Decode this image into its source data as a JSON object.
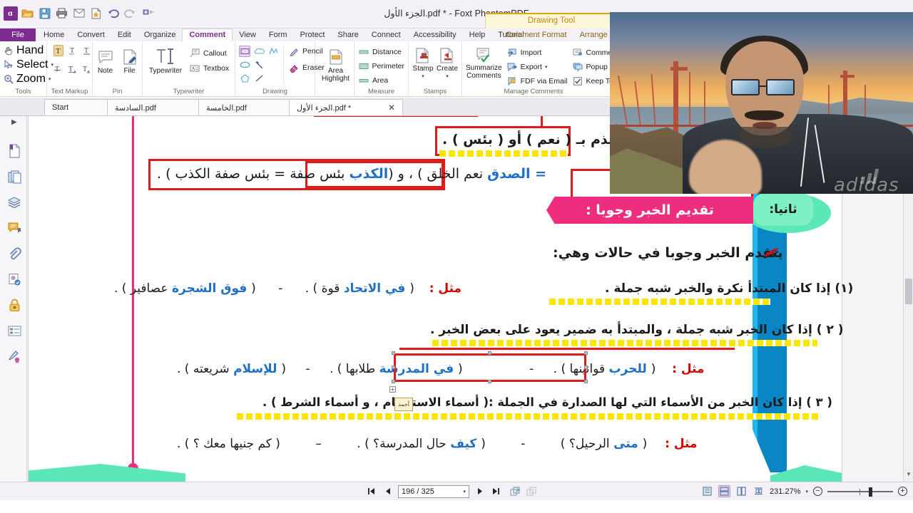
{
  "window": {
    "title": "الجزء الأول.pdf * - Foxt PhantomPDF",
    "app_logo_glyph": "ɑ",
    "contextual_tab_banner": "Drawing Tool"
  },
  "quick_access": [
    {
      "name": "app-menu-icon",
      "tooltip": "Foxit"
    },
    {
      "name": "open-icon",
      "tooltip": "Open"
    },
    {
      "name": "save-icon",
      "tooltip": "Save"
    },
    {
      "name": "print-icon",
      "tooltip": "Print"
    },
    {
      "name": "email-icon",
      "tooltip": "Email"
    },
    {
      "name": "new-from-file-icon",
      "tooltip": "Create PDF"
    },
    {
      "name": "undo-icon",
      "tooltip": "Undo"
    },
    {
      "name": "redo-icon",
      "tooltip": "Redo"
    },
    {
      "name": "customize-icon",
      "tooltip": "Customize Quick Access Toolbar"
    }
  ],
  "menu": {
    "file_label": "File",
    "tabs": [
      {
        "label": "Home",
        "active": false
      },
      {
        "label": "Convert",
        "active": false
      },
      {
        "label": "Edit",
        "active": false
      },
      {
        "label": "Organize",
        "active": false
      },
      {
        "label": "Comment",
        "active": true
      },
      {
        "label": "View",
        "active": false
      },
      {
        "label": "Form",
        "active": false
      },
      {
        "label": "Protect",
        "active": false
      },
      {
        "label": "Share",
        "active": false
      },
      {
        "label": "Connect",
        "active": false
      },
      {
        "label": "Accessibility",
        "active": false
      },
      {
        "label": "Help",
        "active": false
      },
      {
        "label": "Tutorial",
        "active": false
      }
    ],
    "contextual_tabs": [
      {
        "label": "Comment Format"
      },
      {
        "label": "Arrange"
      }
    ]
  },
  "ribbon": {
    "groups": [
      {
        "name": "tools",
        "label": "Tools",
        "items": [
          {
            "label": "Hand",
            "icon": "hand-icon"
          },
          {
            "label": "Select",
            "icon": "select-icon",
            "has_caret": true
          },
          {
            "label": "Zoom",
            "icon": "zoom-icon",
            "has_caret": true
          }
        ]
      },
      {
        "name": "text-markup",
        "label": "Text Markup",
        "items": [
          {
            "label": "Highlight",
            "icon": "highlight-text-icon",
            "selected": true
          },
          {
            "label": "Squiggly",
            "icon": "squiggly-text-icon"
          },
          {
            "label": "Underline",
            "icon": "underline-text-icon"
          },
          {
            "label": "Strikeout",
            "icon": "strikeout-text-icon"
          },
          {
            "label": "Replace Text",
            "icon": "replace-text-icon"
          },
          {
            "label": "Insert Text",
            "icon": "insert-text-icon"
          }
        ]
      },
      {
        "name": "pin",
        "label": "Pin",
        "items": [
          {
            "label": "Note",
            "icon": "note-icon"
          },
          {
            "label": "File",
            "icon": "file-attachment-icon"
          }
        ]
      },
      {
        "name": "typewriter",
        "label": "Typewriter",
        "items": [
          {
            "label": "Typewriter",
            "icon": "typewriter-icon"
          },
          {
            "label": "Callout",
            "icon": "callout-icon"
          },
          {
            "label": "Textbox",
            "icon": "textbox-icon"
          }
        ]
      },
      {
        "name": "drawing",
        "label": "Drawing",
        "items": [
          {
            "label": "Rectangle",
            "icon": "rectangle-icon",
            "selected": true
          },
          {
            "label": "Cloud",
            "icon": "cloud-shape-icon"
          },
          {
            "label": "Polyline",
            "icon": "polyline-icon"
          },
          {
            "label": "Oval",
            "icon": "oval-icon"
          },
          {
            "label": "Arrow",
            "icon": "arrow-icon"
          },
          {
            "label": "Polygon",
            "icon": "polygon-icon"
          },
          {
            "label": "Line",
            "icon": "line-icon"
          },
          {
            "label": "Pencil",
            "icon": "pencil-icon"
          },
          {
            "label": "Eraser",
            "icon": "eraser-icon"
          }
        ]
      },
      {
        "name": "highlight",
        "label": "",
        "items": [
          {
            "label": "Area Highlight",
            "icon": "area-highlight-icon"
          }
        ]
      },
      {
        "name": "measure",
        "label": "Measure",
        "items": [
          {
            "label": "Distance",
            "icon": "distance-icon"
          },
          {
            "label": "Perimeter",
            "icon": "perimeter-icon"
          },
          {
            "label": "Area",
            "icon": "area-measure-icon"
          }
        ]
      },
      {
        "name": "stamps",
        "label": "Stamps",
        "items": [
          {
            "label": "Stamp",
            "icon": "stamp-icon",
            "has_caret": true
          },
          {
            "label": "Create",
            "icon": "create-stamp-icon",
            "has_caret": true
          }
        ]
      },
      {
        "name": "manage-comments",
        "label": "Manage Comments",
        "items": [
          {
            "label": "Summarize Comments",
            "icon": "summarize-comments-icon"
          },
          {
            "label": "Import",
            "icon": "import-icon"
          },
          {
            "label": "Export",
            "icon": "export-icon",
            "has_caret": true
          },
          {
            "label": "FDF via Email",
            "icon": "fdf-email-icon"
          },
          {
            "label": "Comments",
            "icon": "comments-list-icon",
            "has_caret": true
          },
          {
            "label": "Popup Notes",
            "icon": "popup-notes-icon"
          },
          {
            "label": "Keep Tool Se",
            "icon": "checkbox-checked-icon"
          }
        ]
      }
    ]
  },
  "file_tabs": [
    {
      "label": "Start",
      "active": false,
      "closable": false
    },
    {
      "label": "السادسة.pdf",
      "active": false,
      "closable": false
    },
    {
      "label": "الخامسة.pdf",
      "active": false,
      "closable": false
    },
    {
      "label": "الجزء الأول.pdf *",
      "active": true,
      "closable": true,
      "close_glyph": "✕"
    }
  ],
  "left_rail": [
    {
      "name": "panel-toggle-arrow-icon"
    },
    {
      "name": "bookmarks-icon"
    },
    {
      "name": "page-thumbnails-icon"
    },
    {
      "name": "layers-icon"
    },
    {
      "name": "comments-panel-icon"
    },
    {
      "name": "attachments-icon"
    },
    {
      "name": "stamps-panel-icon"
    },
    {
      "name": "security-lock-icon"
    },
    {
      "name": "fields-icon"
    },
    {
      "name": "signatures-icon"
    }
  ],
  "document": {
    "heading_chevron": "تقديم الخبر وجوبا :",
    "heading_pill": "ثانيا:",
    "lines": [
      {
        "id": "line-praise-blame",
        "text": "و الذم بـ ( نعم ) أو ( بئس ) .",
        "highlight": "yellow",
        "boxed": true
      },
      {
        "id": "line-example-sidq",
        "text": "= الصدق نعم الخلق ) ، و ( الكذب بئس صفة  =  بئس صفة الكذب ) .",
        "boxed": true
      },
      {
        "id": "line-intro",
        "text": "يتقدم الخبر وجوبا في حالات وهي:",
        "marker": "pen-marker"
      },
      {
        "id": "rule-1",
        "text": "(١) إذا كان المبتدأ نكرة والخبر شبه جملة .",
        "highlight": "yellow"
      },
      {
        "id": "rule-1-examples",
        "label": "مثل :",
        "text": "( في الاتحاد قوة ) .     -     ( فوق الشجرة عصافير ) ."
      },
      {
        "id": "rule-2",
        "text": "( ٢ ) إذا كان الخبر شبه جملة ، والمبتدأ به ضمير يعود على بعض الخبر .",
        "highlight": "yellow",
        "underline": "red"
      },
      {
        "id": "rule-2-examples",
        "label": "مثل :",
        "text": "( للحرب قوانينها ) .    -    ( في المدرسة طلابها ) .     -     ( للإسلام شريعته ) ."
      },
      {
        "id": "rule-3",
        "text": "( ٣ ) إذا كان الخبر من الأسماء التي لها الصدارة في الجملة :( أسماء الاستفهام ، و أسماء الشرط ) .",
        "highlight": "yellow"
      },
      {
        "id": "rule-3-examples",
        "label": "مثل :",
        "text": "( متى الرحيل؟ )     -     ( كيف حال المدرسة؟ ) .     -     ( كم جنيها معك ؟ ) ."
      }
    ],
    "sticky_note_text": "أحمد",
    "selected_annotation": "في المدرسة طلابها",
    "colors": {
      "annotation_red": "#e01b1b",
      "highlight_yellow": "#ffe600",
      "heading_pink": "#ef2d7e",
      "heading_mint": "#7ef0c6",
      "accent_blue": "#1f6fc4",
      "banner_blue": "#0a86c4"
    }
  },
  "status_bar": {
    "first_page_label": "First Page",
    "prev_page_label": "Previous Page",
    "page_value": "196 / 325",
    "next_page_label": "Next Page",
    "last_page_label": "Last Page",
    "view_modes": [
      {
        "name": "single-page-icon",
        "selected": false
      },
      {
        "name": "continuous-page-icon",
        "selected": true
      },
      {
        "name": "facing-page-icon",
        "selected": false
      },
      {
        "name": "continuous-facing-icon",
        "selected": false
      }
    ],
    "zoom_value": "231.27%",
    "zoom_out_glyph": "−",
    "zoom_in_glyph": "+",
    "dropdown_glyph": "▾"
  },
  "webcam": {
    "name": "presenter-webcam-overlay",
    "brand_text": "adidas"
  }
}
